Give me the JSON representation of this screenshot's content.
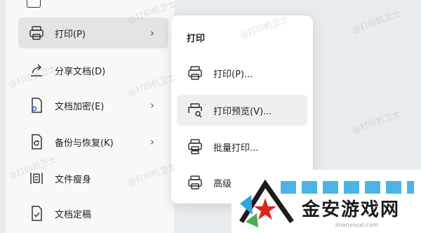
{
  "menu": {
    "items": [
      {
        "label": "打印(P)",
        "icon": "printer-icon",
        "has_submenu": true
      },
      {
        "label": "分享文档(D)",
        "icon": "share-icon",
        "has_submenu": false
      },
      {
        "label": "文档加密(E)",
        "icon": "lock-document-icon",
        "has_submenu": true
      },
      {
        "label": "备份与恢复(K)",
        "icon": "backup-icon",
        "has_submenu": true
      },
      {
        "label": "文件瘦身",
        "icon": "compress-icon",
        "has_submenu": false
      },
      {
        "label": "文档定稿",
        "icon": "finalize-icon",
        "has_submenu": false
      }
    ],
    "chevron": "›"
  },
  "submenu": {
    "title": "打印",
    "items": [
      {
        "label": "打印(P)...",
        "icon": "printer-icon"
      },
      {
        "label": "打印预览(V)...",
        "icon": "print-preview-icon"
      },
      {
        "label": "批量打印...",
        "icon": "batch-print-icon"
      },
      {
        "label": "高级",
        "icon": "advanced-print-icon"
      }
    ]
  },
  "watermark": "@打印机卫士",
  "logo": {
    "brand": "金安游戏网",
    "url": "jinanyouxi.com"
  },
  "colors": {
    "panel_bg": "#f8f8f8",
    "active_bg": "#e4e4e4",
    "hover_bg": "#efefef",
    "accent": "#2aa7e0",
    "logo_red": "#d9261c"
  }
}
